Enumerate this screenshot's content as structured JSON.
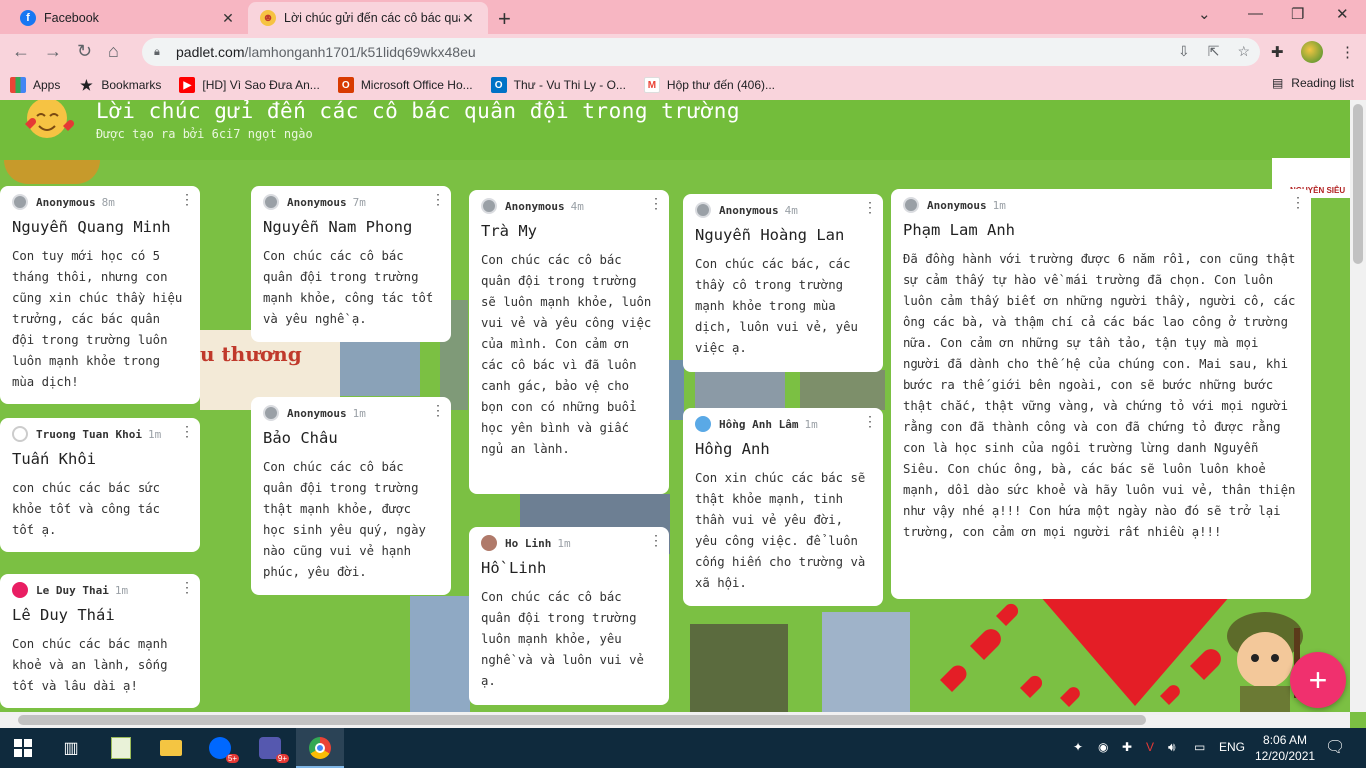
{
  "browser": {
    "tabs": [
      {
        "title": "Facebook",
        "icon": "facebook-icon",
        "active": false
      },
      {
        "title": "Lời chúc gửi đến các cô bác quân",
        "icon": "padlet-emoji-icon",
        "active": true
      }
    ],
    "url_host": "padlet.com",
    "url_path": "/lamhonganh1701/k51lidq69wkx48eu",
    "bookmarks": [
      {
        "label": "Apps",
        "icon": "apps-grid-icon"
      },
      {
        "label": "Bookmarks",
        "icon": "star-icon"
      },
      {
        "label": "[HD] Vì Sao Đưa An...",
        "icon": "youtube-icon"
      },
      {
        "label": "Microsoft Office Ho...",
        "icon": "office-icon"
      },
      {
        "label": "Thư - Vu Thi Ly - O...",
        "icon": "outlook-icon"
      },
      {
        "label": "Hộp thư đến (406)...",
        "icon": "gmail-icon"
      }
    ],
    "reading_list": "Reading list"
  },
  "padlet": {
    "title": "Lời chúc gửi đến các cô bác quân đội trong trường",
    "subtitle": "Được tạo ra bởi 6ci7 ngọt ngào",
    "bg_text": "u thương",
    "bg_badge": "NGUYỄN SIÊU",
    "posts": [
      {
        "author": "Anonymous",
        "time": "8m",
        "title": "Nguyễn Quang Minh",
        "body": "Con tuy mới học có 5 tháng thôi, nhưng con cũng xin chúc thầy hiệu trưởng, các bác quân đội trong trường luôn luôn mạnh khỏe trong mùa dịch!"
      },
      {
        "author": "Truong Tuan Khoi",
        "time": "1m",
        "title": "Tuấn Khôi",
        "body": "con chúc các bác sức khỏe tốt và công tác tốt ạ."
      },
      {
        "author": "Le Duy Thai",
        "time": "1m",
        "title": "Lê Duy Thái",
        "body": "Con chúc các bác mạnh khoẻ và an lành, sống tốt và lâu dài ạ!"
      },
      {
        "author": "Anonymous",
        "time": "7m",
        "title": "Nguyễn Nam Phong",
        "body": "Con chúc các cô bác quân đội trong trường mạnh khỏe, công tác tốt và yêu nghề ạ."
      },
      {
        "author": "Anonymous",
        "time": "1m",
        "title": "Bảo Châu",
        "body": "Con chúc các cô bác quân đội trong trường thật mạnh khỏe, được học sinh yêu quý, ngày nào cũng vui vẻ hạnh phúc, yêu đời."
      },
      {
        "author": "Anonymous",
        "time": "4m",
        "title": "Trà My",
        "body": "Con chúc các cô bác quân đội trong trường sẽ luôn mạnh khỏe, luôn vui vẻ và yêu công việc của mình. Con cảm ơn các cô bác vì đã luôn canh gác, bảo vệ cho bọn con có những buổi học yên bình và giấc ngủ an lành."
      },
      {
        "author": "Ho Linh",
        "time": "1m",
        "title": "Hồ Linh",
        "body": "Con chúc các cô bác quân đội trong trường luôn mạnh khỏe, yêu nghề và và luôn vui vẻ ạ."
      },
      {
        "author": "Anonymous",
        "time": "4m",
        "title": "Nguyễn Hoàng Lan",
        "body": "Con chúc các bác, các thầy cô trong trường mạnh khỏe trong mùa dịch, luôn vui vẻ, yêu việc ạ."
      },
      {
        "author": "Hồng Anh Lâm",
        "time": "1m",
        "title": "Hồng Anh",
        "body": "Con xin chúc các bác sẽ thật khỏe mạnh, tinh thần vui vẻ yêu đời, yêu công việc. để luôn cống hiến cho trường và xã hội."
      },
      {
        "author": "Anonymous",
        "time": "1m",
        "title": "Phạm Lam Anh",
        "body": "Đã đồng hành với trường được 6 năm rồi, con cũng thật sự cảm thấy tự hào về mái trường đã chọn. Con luôn luôn cảm thấy biết ơn những người thầy, người cô, các ông các bà, và thậm chí cả các bác lao công ở trường nữa. Con cảm ơn những sự tần tảo, tận tụy mà mọi người đã dành cho thế hệ của chúng con. Mai sau, khi bước ra thế giới bên ngoài, con sẽ bước những bước thật chắc, thật vững vàng, và chứng tỏ với mọi người rằng con đã thành công và con đã chứng tỏ được rằng con là học sinh của ngôi trường lừng danh Nguyễn Siêu. Con chúc ông, bà, các bác sẽ luôn luôn khoẻ mạnh, dồi dào sức khoẻ và hãy luôn vui vẻ, thân thiện như vậy nhé ạ!!! Con hứa một ngày nào đó sẽ trở lại trường, con cảm ơn mọi người rất nhiều ạ!!!"
      }
    ],
    "add_button": "+"
  },
  "taskbar": {
    "time": "8:06 AM",
    "date": "12/20/2021",
    "lang": "ENG",
    "badges": {
      "zalo": "5+",
      "teams": "9+"
    }
  },
  "colors": {
    "accent": "#f0306e",
    "board_bg": "#7bc043",
    "chrome_pink": "#f7b6c2"
  }
}
